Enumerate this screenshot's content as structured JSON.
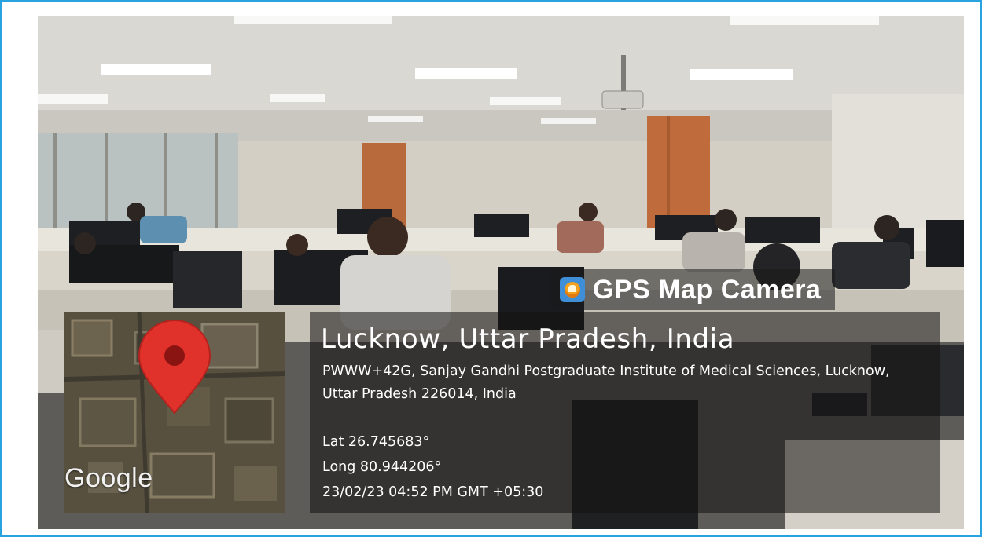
{
  "badge": {
    "app_name": "GPS Map Camera",
    "icon": "gps-map-camera-app-icon"
  },
  "location": {
    "title": "Lucknow, Uttar Pradesh, India",
    "address": "PWWW+42G, Sanjay Gandhi Postgraduate Institute of Medical Sciences, Lucknow, Uttar Pradesh 226014, India",
    "latitude": "Lat 26.745683°",
    "longitude": "Long 80.944206°",
    "timestamp": "23/02/23 04:52 PM GMT +05:30"
  },
  "map": {
    "provider_logo": "Google",
    "pin_icon": "map-pin-icon"
  },
  "colors": {
    "frame_border": "#29a3df",
    "pin": "#e0312b",
    "caption_background": "rgba(20,18,18,0.55)"
  }
}
